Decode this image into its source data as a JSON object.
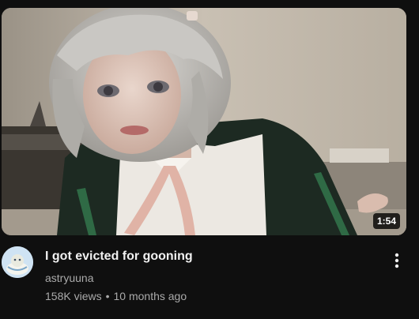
{
  "video": {
    "title": "I got evicted for gooning",
    "channel": "astryuuna",
    "views": "158K views",
    "separator": "•",
    "age": "10 months ago",
    "duration": "1:54"
  },
  "icons": {
    "menu": "more-vert-icon",
    "avatar": "channel-avatar"
  },
  "colors": {
    "background": "#0f0f0f",
    "title": "#f1f1f1",
    "secondary_text": "#aaaaaa"
  }
}
